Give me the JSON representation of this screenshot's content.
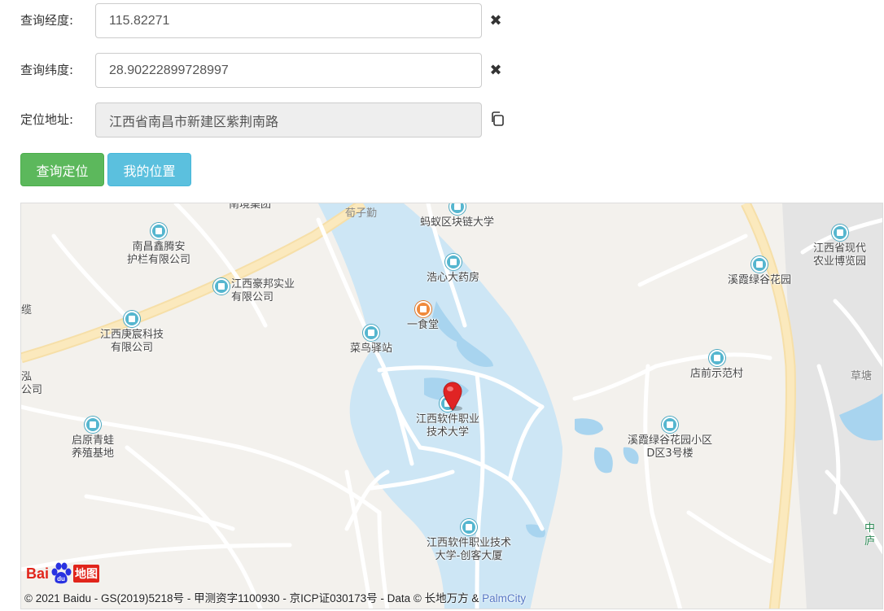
{
  "form": {
    "longitude": {
      "label": "查询经度:",
      "value": "115.82271"
    },
    "latitude": {
      "label": "查询纬度:",
      "value": "28.90222899728997"
    },
    "address": {
      "label": "定位地址:",
      "value": "江西省南昌市新建区紫荆南路"
    }
  },
  "buttons": {
    "query_label": "查询定位",
    "my_location_label": "我的位置",
    "query_color": "#5cb85c",
    "my_location_color": "#5bc0de"
  },
  "map": {
    "pois": [
      {
        "name": "南境集团"
      },
      {
        "name": "蚂蚁区块链大学"
      },
      {
        "name": "南昌鑫腾安\n护栏有限公司"
      },
      {
        "name": "江西豪邦实业\n有限公司"
      },
      {
        "name": "浩心大药房"
      },
      {
        "name": "一食堂"
      },
      {
        "name": "江西庚宸科技\n有限公司"
      },
      {
        "name": "菜鸟驿站"
      },
      {
        "name": "江西软件职业\n技术大学"
      },
      {
        "name": "启原青蛙\n养殖基地"
      },
      {
        "name": "溪霞绿谷花园"
      },
      {
        "name": "江西省现代\n农业博览园"
      },
      {
        "name": "店前示范村"
      },
      {
        "name": "溪霞绿谷花园小区\nD区3号楼"
      },
      {
        "name": "江西软件职业技术\n大学-创客大厦"
      }
    ],
    "edge_labels": [
      "荀子勤",
      "缆",
      "泓\n公司",
      "草塘",
      "中\n庐"
    ],
    "logo": {
      "brand_left": "Bai",
      "brand_right": "地图"
    },
    "copyright_text": "© 2021 Baidu - GS(2019)5218号 - 甲测资字1100930 - 京ICP证030173号 - Data © 长地万方 & ",
    "copyright_link": "PalmCity"
  }
}
